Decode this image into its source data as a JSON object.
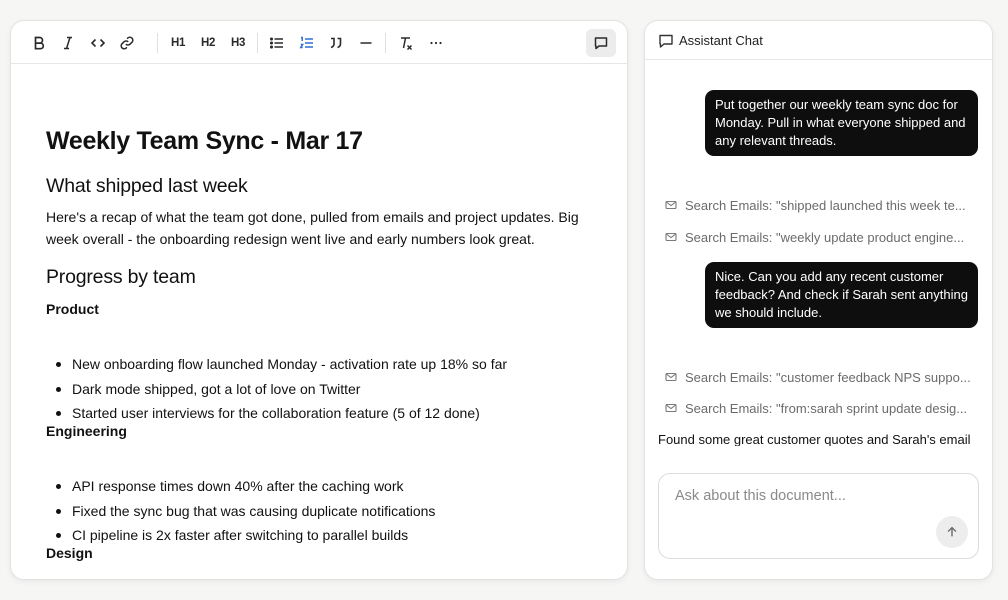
{
  "toolbar": {
    "h1": "H1",
    "h2": "H2",
    "h3": "H3"
  },
  "document": {
    "title": "Weekly Team Sync - Mar 17",
    "section1_heading": "What shipped last week",
    "section1_paragraph": "Here's a recap of what the team got done, pulled from emails and project updates. Big week overall - the onboarding redesign went live and early numbers look great.",
    "section2_heading": "Progress by team",
    "teams": [
      {
        "name": "Product",
        "items": [
          "New onboarding flow launched Monday - activation rate up 18% so far",
          "Dark mode shipped, got a lot of love on Twitter",
          "Started user interviews for the collaboration feature (5 of 12 done)"
        ]
      },
      {
        "name": "Engineering",
        "items": [
          "API response times down 40% after the caching work",
          "Fixed the sync bug that was causing duplicate notifications",
          "CI pipeline is 2x faster after switching to parallel builds"
        ]
      },
      {
        "name": "Design",
        "items": []
      }
    ]
  },
  "chat": {
    "title": "Assistant Chat",
    "messages": [
      "Put together our weekly team sync doc for Monday. Pull in what everyone shipped and any relevant threads.",
      "Nice. Can you add any recent customer feedback? And check if Sarah sent anything we should include."
    ],
    "tool_calls": [
      "Search Emails: \"shipped launched this week te...",
      "Search Emails: \"weekly update product engine...",
      "Search Emails: \"customer feedback NPS suppo...",
      "Search Emails: \"from:sarah sprint update desig..."
    ],
    "reply_preview": "Found some great customer quotes and Sarah's email",
    "input_placeholder": "Ask about this document..."
  }
}
